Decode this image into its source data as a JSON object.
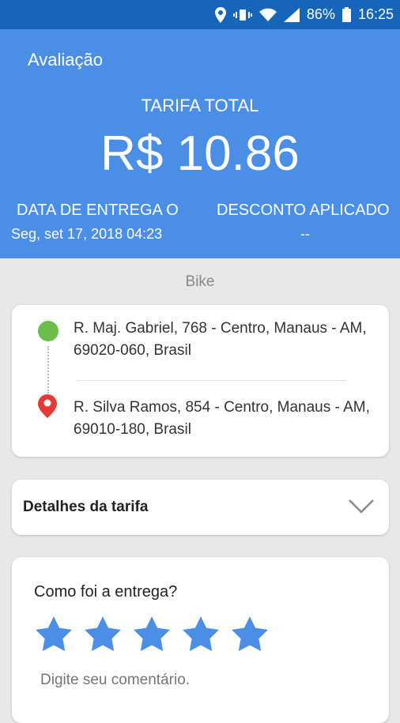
{
  "status_bar": {
    "battery_percent": "86%",
    "time": "16:25",
    "icons": [
      "location-icon",
      "vibrate-icon",
      "wifi-icon",
      "signal-icon",
      "battery-icon"
    ]
  },
  "header": {
    "title": "Avaliação",
    "total_label": "TARIFA TOTAL",
    "total_value": "R$ 10.86",
    "delivery_date_label": "DATA DE ENTREGA O",
    "delivery_date_value": "Seg, set 17, 2018 04:23",
    "discount_label": "DESCONTO APLICADO",
    "discount_value": "--"
  },
  "vehicle": "Bike",
  "route": {
    "origin": "R. Maj. Gabriel, 768 - Centro, Manaus - AM, 69020-060, Brasil",
    "destination": "R. Silva Ramos, 854 - Centro, Manaus - AM, 69010-180, Brasil"
  },
  "fare_details": {
    "label": "Detalhes da tarifa"
  },
  "rating": {
    "question": "Como foi a entrega?",
    "stars": 5,
    "max_stars": 5,
    "comment_placeholder": "Digite seu comentário."
  },
  "colors": {
    "status_bar": "#1565b8",
    "header": "#4a8ee6",
    "star": "#4a8ee6",
    "origin_dot": "#69bf4a",
    "destination_pin": "#e53935"
  }
}
